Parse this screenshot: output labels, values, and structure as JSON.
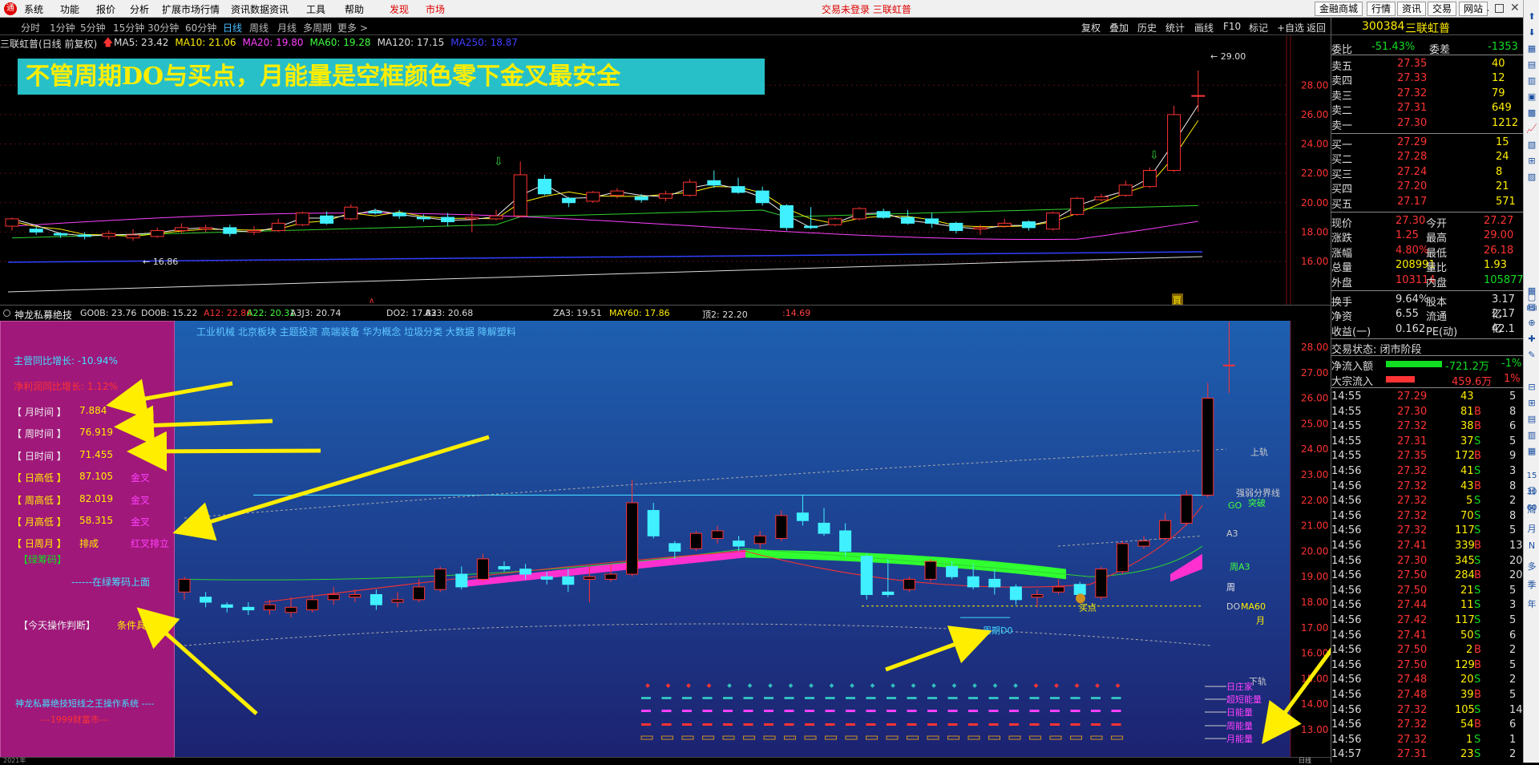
{
  "menu": {
    "items": [
      "系统",
      "功能",
      "报价",
      "分析",
      "扩展市场行情",
      "资讯数据",
      "资讯",
      "工具",
      "帮助"
    ],
    "faxian": "发现",
    "shichang": "市场",
    "center": "交易未登录  三联虹普",
    "right": [
      "金融商城",
      "行情",
      "资讯",
      "交易",
      "网站"
    ]
  },
  "periods": [
    "分时",
    "1分钟",
    "5分钟",
    "15分钟",
    "30分钟",
    "60分钟",
    "日线",
    "周线",
    "月线",
    "多周期",
    "更多 >"
  ],
  "tools": [
    "复权",
    "叠加",
    "历史",
    "统计",
    "画线",
    "F10",
    "标记",
    "+自选",
    "返回"
  ],
  "chart": {
    "name": "三联虹普(日线 前复权)",
    "ma": [
      "MA5: 23.42",
      "MA10: 21.06",
      "MA20: 19.80",
      "MA60: 19.28",
      "MA120: 17.15",
      "MA250: 18.87"
    ],
    "banner": "不管周期DO与买点，月能量是空框颜色零下金叉最安全",
    "high_label": "29.00",
    "low_label": "16.86",
    "y_ticks": [
      "28.00",
      "26.00",
      "24.00",
      "22.00",
      "20.00",
      "18.00",
      "16.00"
    ],
    "buy_mark": "買",
    "low_mark": "∧"
  },
  "indicator": {
    "name": "神龙私募绝技",
    "values": [
      "GO0B: 23.76",
      "DO0B: 15.22",
      "A12: 22.86",
      "A22: 20.31",
      "A3J3: 20.74",
      "DO2: 17.82",
      "A33: 20.68",
      "ZA3: 19.51",
      "MAY60: 17.86",
      "顶2: 22.20",
      ":14.69"
    ],
    "tags": "工业机械  北京板块  主题投资  高端装备  华为概念  垃圾分类  大数据  降解塑料",
    "y_ticks": [
      "28.00",
      "27.00",
      "26.00",
      "25.00",
      "24.00",
      "23.00",
      "22.00",
      "21.00",
      "20.00",
      "19.00",
      "18.00",
      "17.00",
      "16.00",
      "15.00",
      "14.00",
      "13.00"
    ],
    "labels": {
      "shangui": "上轨",
      "go": "GO",
      "xingpai": "强弱分界线",
      "tupo": "突破",
      "a3": "A3",
      "zhou_a3": "周A3",
      "zhou": "周",
      "ma60": "MA60",
      "do": "DO",
      "yue": "月",
      "xiagui": "下轨",
      "zhouqi": "周期D0",
      "maidian": "买点",
      "rizhuangjia": "日庄家",
      "chaoduan": "超短能量",
      "rineng": "日能量",
      "zhouneng": "周能量",
      "yueneng": "月能量"
    }
  },
  "side": {
    "growth1": "主营同比增长: -10.94%",
    "growth2": "净利润同比增长: 1.12%",
    "rows": [
      {
        "k": "【 月时间 】",
        "v": "7.884",
        "t": ""
      },
      {
        "k": "【 周时间 】",
        "v": "76.919",
        "t": ""
      },
      {
        "k": "【 日时间 】",
        "v": "71.455",
        "t": ""
      },
      {
        "k": "【 日高低 】",
        "v": "87.105",
        "t": "金叉"
      },
      {
        "k": "【 周高低 】",
        "v": "82.019",
        "t": "金叉"
      },
      {
        "k": "【 月高低 】",
        "v": "58.315",
        "t": "金叉"
      },
      {
        "k": "【 日周月 】",
        "v": "排成",
        "t": "红叉排立"
      }
    ],
    "chip": "【绿筹码】",
    "chip_note": "------在绿筹码上面",
    "judge": "【今天操作判断】",
    "judge_v": "条件具备",
    "footer1": "神龙私募绝技短线之王操作系统 ----",
    "footer2": "---1999财富市---"
  },
  "quote": {
    "code": "300384",
    "name": "三联虹普",
    "weibi": "委比",
    "weibi_v": "-51.43%",
    "weicha": "委差",
    "weicha_v": "-1353",
    "sells": [
      {
        "l": "卖五",
        "p": "27.35",
        "v": "40"
      },
      {
        "l": "卖四",
        "p": "27.33",
        "v": "12"
      },
      {
        "l": "卖三",
        "p": "27.32",
        "v": "79"
      },
      {
        "l": "卖二",
        "p": "27.31",
        "v": "649"
      },
      {
        "l": "卖一",
        "p": "27.30",
        "v": "1212"
      }
    ],
    "buys": [
      {
        "l": "买一",
        "p": "27.29",
        "v": "15"
      },
      {
        "l": "买二",
        "p": "27.28",
        "v": "24"
      },
      {
        "l": "买三",
        "p": "27.24",
        "v": "8"
      },
      {
        "l": "买四",
        "p": "27.20",
        "v": "21"
      },
      {
        "l": "买五",
        "p": "27.17",
        "v": "571"
      }
    ],
    "stats": [
      {
        "a": "现价",
        "b": "27.30",
        "c": "今开",
        "d": "27.27"
      },
      {
        "a": "涨跌",
        "b": "1.25",
        "c": "最高",
        "d": "29.00"
      },
      {
        "a": "涨幅",
        "b": "4.80%",
        "c": "最低",
        "d": "26.18"
      },
      {
        "a": "总量",
        "b": "208991",
        "c": "量比",
        "d": "1.93"
      },
      {
        "a": "外盘",
        "b": "103114",
        "c": "内盘",
        "d": "105877"
      }
    ],
    "stats2": [
      {
        "a": "换手",
        "b": "9.64%",
        "c": "股本",
        "d": "3.17亿"
      },
      {
        "a": "净资",
        "b": "6.55",
        "c": "流通",
        "d": "2.17亿"
      },
      {
        "a": "收益(一)",
        "b": "0.162",
        "c": "PE(动)",
        "d": "42.1"
      }
    ],
    "status": "交易状态: 闭市阶段",
    "flow1": "净流入额",
    "flow1_v": "-721.2万",
    "flow1_p": "-1%",
    "flow2": "大宗流入",
    "flow2_v": "459.6万",
    "flow2_p": "1%",
    "ticks": [
      [
        "14:55",
        "27.29",
        "43",
        "",
        5
      ],
      [
        "14:55",
        "27.30",
        "81",
        "B",
        8
      ],
      [
        "14:55",
        "27.32",
        "38",
        "B",
        6
      ],
      [
        "14:55",
        "27.31",
        "37",
        "S",
        5
      ],
      [
        "14:55",
        "27.35",
        "172",
        "B",
        9
      ],
      [
        "14:56",
        "27.32",
        "41",
        "S",
        3
      ],
      [
        "14:56",
        "27.32",
        "43",
        "B",
        8
      ],
      [
        "14:56",
        "27.32",
        "5",
        "S",
        2
      ],
      [
        "14:56",
        "27.32",
        "70",
        "S",
        8
      ],
      [
        "14:56",
        "27.32",
        "117",
        "S",
        5
      ],
      [
        "14:56",
        "27.41",
        "339",
        "B",
        13
      ],
      [
        "14:56",
        "27.30",
        "345",
        "S",
        20
      ],
      [
        "14:56",
        "27.50",
        "284",
        "B",
        20
      ],
      [
        "14:56",
        "27.50",
        "21",
        "S",
        5
      ],
      [
        "14:56",
        "27.44",
        "11",
        "S",
        3
      ],
      [
        "14:56",
        "27.42",
        "117",
        "S",
        5
      ],
      [
        "14:56",
        "27.41",
        "50",
        "S",
        6
      ],
      [
        "14:56",
        "27.50",
        "2",
        "B",
        2
      ],
      [
        "14:56",
        "27.50",
        "129",
        "B",
        5
      ],
      [
        "14:56",
        "27.48",
        "20",
        "S",
        2
      ],
      [
        "14:56",
        "27.48",
        "39",
        "B",
        5
      ],
      [
        "14:56",
        "27.32",
        "105",
        "S",
        14
      ],
      [
        "14:56",
        "27.32",
        "54",
        "B",
        6
      ],
      [
        "14:56",
        "27.32",
        "1",
        "S",
        1
      ],
      [
        "14:57",
        "27.31",
        "23",
        "S",
        2
      ]
    ]
  },
  "sidebar_icons": [
    "RSI",
    "日",
    "周",
    "月",
    "N",
    "多",
    "季",
    "年"
  ],
  "bottom": {
    "date": "2021年",
    "right": "日线"
  },
  "colors": {
    "up": "#ff3333",
    "down": "#40f0ff",
    "banner_bg": "#27c0c8",
    "banner_fg": "#ffee00",
    "panel_bg": "#a0187a",
    "ind_bg_top": "#1e5fb0",
    "ind_bg_bot": "#1c2270"
  }
}
